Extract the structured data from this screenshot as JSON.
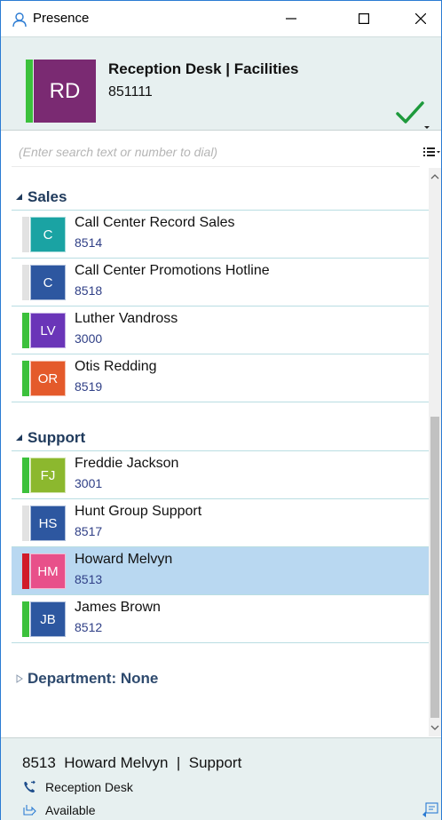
{
  "window": {
    "title": "Presence"
  },
  "profile": {
    "initials": "RD",
    "name": "Reception Desk | Facilities",
    "extension": "851111",
    "avatar_color": "#7a2a72",
    "status_color": "#3cc13c"
  },
  "search": {
    "placeholder": "(Enter search text or number to dial)",
    "value": ""
  },
  "groups": [
    {
      "name": "Sales",
      "expanded": true,
      "contacts": [
        {
          "initials": "C",
          "name": "Call Center Record Sales",
          "extension": "8514",
          "avatar_color": "#1aa3a3",
          "status_color": "#e2e2e2"
        },
        {
          "initials": "C",
          "name": "Call Center Promotions Hotline",
          "extension": "8518",
          "avatar_color": "#2d57a0",
          "status_color": "#e2e2e2"
        },
        {
          "initials": "LV",
          "name": "Luther Vandross",
          "extension": "3000",
          "avatar_color": "#6a35b8",
          "status_color": "#3cc13c"
        },
        {
          "initials": "OR",
          "name": "Otis Redding",
          "extension": "8519",
          "avatar_color": "#e45a2b",
          "status_color": "#3cc13c"
        }
      ]
    },
    {
      "name": "Support",
      "expanded": true,
      "contacts": [
        {
          "initials": "FJ",
          "name": "Freddie Jackson",
          "extension": "3001",
          "avatar_color": "#8cb82e",
          "status_color": "#3cc13c"
        },
        {
          "initials": "HS",
          "name": "Hunt Group Support",
          "extension": "8517",
          "avatar_color": "#2d57a0",
          "status_color": "#e2e2e2"
        },
        {
          "initials": "HM",
          "name": "Howard Melvyn",
          "extension": "8513",
          "avatar_color": "#e8508a",
          "status_color": "#d11b2a",
          "selected": true
        },
        {
          "initials": "JB",
          "name": "James Brown",
          "extension": "8512",
          "avatar_color": "#2d57a0",
          "status_color": "#3cc13c"
        }
      ]
    },
    {
      "name": "Department: None",
      "expanded": false,
      "contacts": []
    }
  ],
  "footer": {
    "extension": "8513",
    "name": "Howard Melvyn",
    "separator": "|",
    "department": "Support",
    "call_target": "Reception Desk",
    "presence": "Available"
  },
  "icons": {
    "app": "person-icon",
    "minimize": "minimize-icon",
    "maximize": "maximize-icon",
    "close": "close-icon",
    "status": "checkmark-icon",
    "view": "list-view-icon",
    "call": "phone-forward-icon",
    "presence": "presence-arrow-icon",
    "corner": "chat-window-icon"
  }
}
